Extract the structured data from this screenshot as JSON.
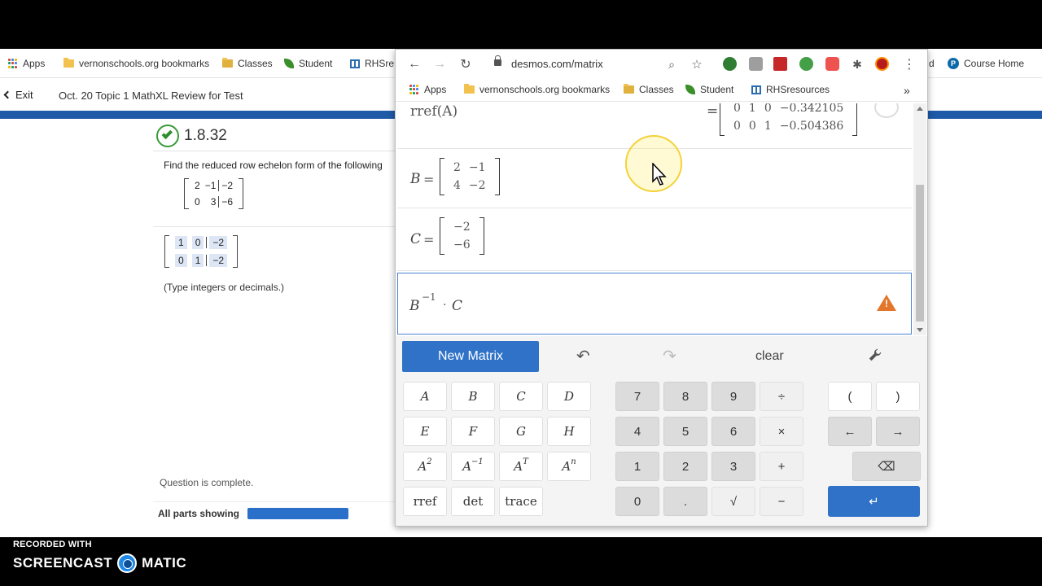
{
  "background_browser": {
    "bookmarks": {
      "apps": "Apps",
      "vernon": "vernonschools.org bookmarks",
      "classes": "Classes",
      "student": "Student",
      "rhsres_partial": "RHSre",
      "partial_d": "d",
      "course_home": "Course Home"
    },
    "exit_label": "Exit",
    "assignment_title": "Oct. 20 Topic 1 MathXL Review for Test",
    "question_number": "1.8.32",
    "prompt": "Find the reduced row echelon form of the following",
    "given_matrix": [
      [
        "2",
        "−1",
        "−2"
      ],
      [
        "0",
        "3",
        "−6"
      ]
    ],
    "answer_matrix": [
      [
        "1",
        "0",
        "−2"
      ],
      [
        "0",
        "1",
        "−2"
      ]
    ],
    "type_hint": "(Type integers or decimals.)",
    "question_status": "Question is complete.",
    "parts_label": "All parts showing",
    "progress_fraction": 1.0
  },
  "popup": {
    "url": "desmos.com/matrix",
    "bookmarks": {
      "apps": "Apps",
      "vernon": "vernonschools.org bookmarks",
      "classes": "Classes",
      "student": "Student",
      "rhs": "RHSresources",
      "more": "»"
    },
    "expressions": {
      "rref": {
        "label": "rref(A)",
        "eq": "=",
        "result": [
          [
            "0",
            "1",
            "0",
            "−0.342105"
          ],
          [
            "0",
            "0",
            "1",
            "−0.504386"
          ]
        ]
      },
      "b": {
        "label": "B",
        "eq": "=",
        "matrix": [
          [
            "2",
            "−1"
          ],
          [
            "4",
            "−2"
          ]
        ]
      },
      "c": {
        "label": "C",
        "eq": "=",
        "matrix": [
          [
            "−2"
          ],
          [
            "−6"
          ]
        ]
      },
      "active": {
        "base": "B",
        "exp": "−1",
        "dot": "·",
        "rhs": "C"
      }
    },
    "keypad": {
      "new_matrix": "New Matrix",
      "clear": "clear",
      "undo": "↶",
      "redo": "↷",
      "matrix_keys": [
        "A",
        "B",
        "C",
        "D",
        "E",
        "F",
        "G",
        "H"
      ],
      "power_keys": {
        "sq_base": "A",
        "sq_exp": "2",
        "inv_base": "A",
        "inv_exp": "−1",
        "t_base": "A",
        "t_exp": "T",
        "n_base": "A",
        "n_exp": "n"
      },
      "func_keys": [
        "rref",
        "det",
        "trace"
      ],
      "digits": [
        "7",
        "8",
        "9",
        "4",
        "5",
        "6",
        "1",
        "2",
        "3",
        "0",
        "."
      ],
      "ops": {
        "divide": "÷",
        "times": "×",
        "plus": "+",
        "minus": "−",
        "sqrt": "√"
      },
      "parens": {
        "open": "(",
        "close": ")"
      },
      "arrows": {
        "left": "←",
        "right": "→"
      },
      "backspace": "⌫",
      "enter": "↵"
    }
  },
  "recorder": {
    "recorded_with": "RECORDED WITH",
    "brand_left": "SCREENCAST",
    "brand_right": "MATIC"
  },
  "colors": {
    "accent_blue": "#2f72c8",
    "mathxl_blue": "#1e5aa8",
    "warning_orange": "#e3762b",
    "check_green": "#2f8f2f"
  }
}
